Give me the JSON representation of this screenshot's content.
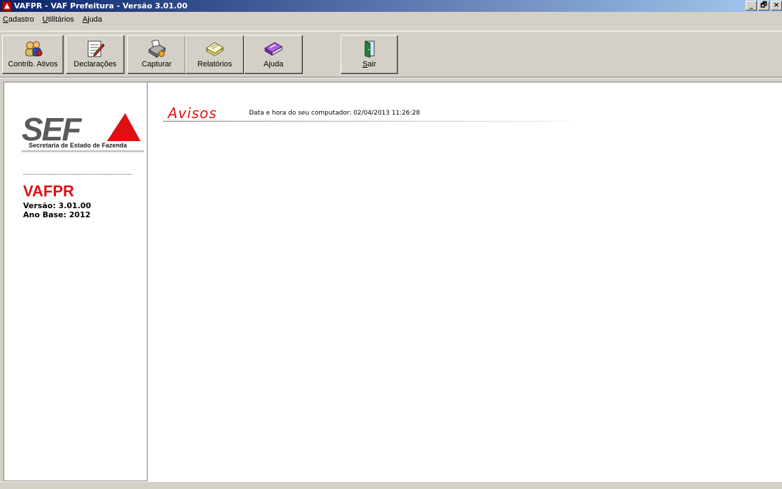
{
  "window": {
    "title": "VAFPR - VAF Prefeitura - Versão 3.01.00",
    "controls": [
      "_",
      "🗗",
      "×"
    ]
  },
  "menu": [
    {
      "acc": "C",
      "rest": "adastro"
    },
    {
      "acc": "U",
      "rest": "tilitários"
    },
    {
      "acc": "A",
      "rest": "juda"
    }
  ],
  "toolbar": {
    "contrib_label": "Contrib. Ativos",
    "declaracoes_label": "Declarações",
    "capturar_label": "Capturar",
    "relatorios_label": "Relatórios",
    "ajuda_label": "Ajuda",
    "sair_acc": "S",
    "sair_rest": "air"
  },
  "sidebar": {
    "logo_text": "SEF",
    "logo_subtitle": "Secretaria de Estado de Fazenda",
    "app_name": "VAFPR",
    "version": "Versão: 3.01.00",
    "ano_base": "Ano Base: 2012"
  },
  "content": {
    "heading": "Avisos",
    "datetime": "Data e hora do seu computador: 02/04/2013 11:26:28"
  },
  "colors": {
    "accent_red": "#e01010",
    "titlebar_start": "#0a246a",
    "titlebar_end": "#a6caf0"
  },
  "icons": {
    "contrib": "people-icon",
    "declaracoes": "document-pen-icon",
    "capturar": "fax-machine-icon",
    "relatorios": "paper-stack-icon",
    "ajuda": "book-icon",
    "sair": "door-exit-icon"
  }
}
